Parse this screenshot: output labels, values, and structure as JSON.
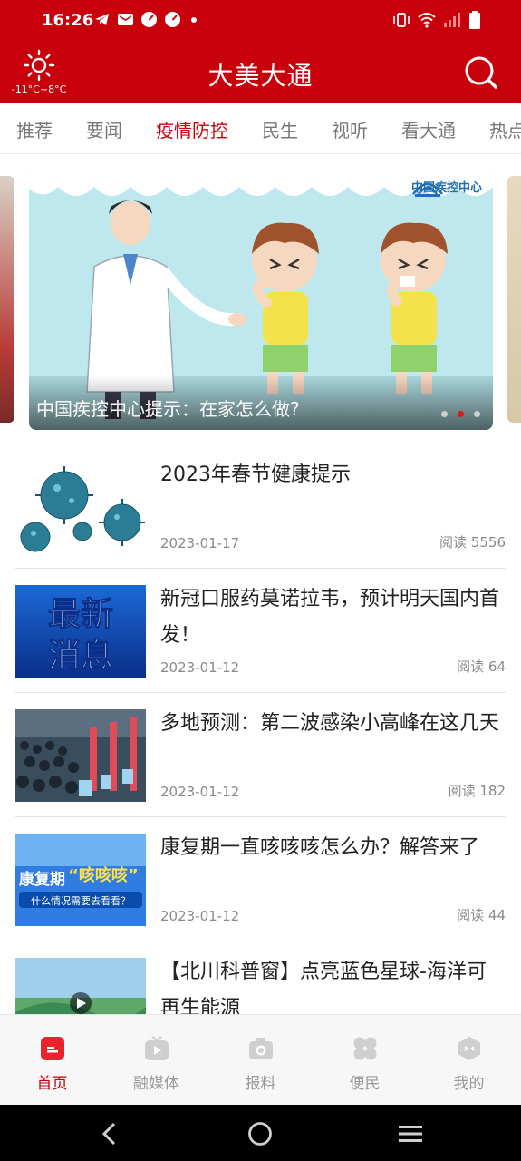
{
  "status_bar": {
    "time": "16:26",
    "left_icons": [
      "telegram-icon",
      "mail-icon",
      "speed-icon",
      "speed-icon",
      "dot-icon"
    ],
    "right_icons": [
      "vibrate-icon",
      "wifi-icon",
      "signal-icon",
      "battery-icon"
    ]
  },
  "header": {
    "title": "大美大通",
    "weather_temp": "-11°C~8°C",
    "weather_icon": "sun-icon",
    "search_icon": "search-icon"
  },
  "tabs": [
    {
      "label": "推荐",
      "active": false
    },
    {
      "label": "要闻",
      "active": false
    },
    {
      "label": "疫情防控",
      "active": true
    },
    {
      "label": "民生",
      "active": false
    },
    {
      "label": "视听",
      "active": false
    },
    {
      "label": "看大通",
      "active": false
    },
    {
      "label": "热点",
      "active": false
    }
  ],
  "carousel": {
    "caption": "中国疾控中心提示：在家怎么做?",
    "logo_text": "中国疾控中心",
    "slide_count": 3,
    "active_index": 1
  },
  "news": [
    {
      "title": "2023年春节健康提示",
      "date": "2023-01-17",
      "reads": "阅读 5556",
      "thumb": "virus-image"
    },
    {
      "title": "新冠口服药莫诺拉韦，预计明天国内首发！",
      "date": "2023-01-12",
      "reads": "阅读 64",
      "thumb": "latest-news-image",
      "thumb_text_1": "最新",
      "thumb_text_2": "消息"
    },
    {
      "title": "多地预测：第二波感染小高峰在这几天",
      "date": "2023-01-12",
      "reads": "阅读 182",
      "thumb": "crowd-image"
    },
    {
      "title": "康复期一直咳咳咳怎么办？解答来了",
      "date": "2023-01-12",
      "reads": "阅读 44",
      "thumb": "cough-image",
      "thumb_text_1": "康复期",
      "thumb_text_2": "“咳咳咳”",
      "thumb_text_3": "什么情况需要去看看？"
    },
    {
      "title": "【北川科普窗】点亮蓝色星球-海洋可再生能源",
      "date": "",
      "reads": "",
      "thumb": "video-image"
    }
  ],
  "bottom_nav": [
    {
      "label": "首页",
      "icon": "home-icon",
      "active": true
    },
    {
      "label": "融媒体",
      "icon": "media-icon",
      "active": false
    },
    {
      "label": "报料",
      "icon": "camera-icon",
      "active": false
    },
    {
      "label": "便民",
      "icon": "grid-icon",
      "active": false
    },
    {
      "label": "我的",
      "icon": "profile-icon",
      "active": false
    }
  ],
  "colors": {
    "brand_red": "#c8000b",
    "text_dark": "#222222",
    "text_gray": "#8a8a8a"
  }
}
